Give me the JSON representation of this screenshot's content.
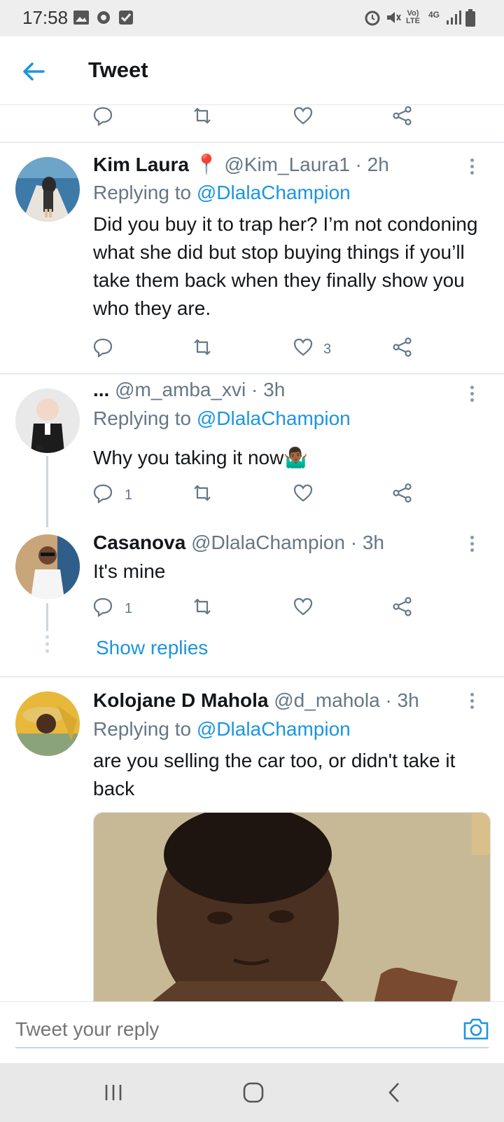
{
  "status_bar": {
    "time": "17:58",
    "network": "4G"
  },
  "header": {
    "title": "Tweet"
  },
  "tweets": [
    {
      "name": "Kim Laura",
      "handle_time": " 📍 @Kim_Laura1 · 2h",
      "replying_prefix": "Replying to ",
      "replying_to": "@DlalaChampion",
      "body": "Did you buy it to trap her? I’m not condoning what she did but stop buying things if you’ll take them back when they finally show you who they are.",
      "likes": "3"
    },
    {
      "name": "...",
      "handle_time": " @m_amba_xvi · 3h",
      "replying_prefix": "Replying to ",
      "replying_to": "@DlalaChampion",
      "body": "Why you taking it now🤷🏾‍♂️",
      "replies": "1"
    },
    {
      "name": "Casanova",
      "handle_time": " @DlalaChampion · 3h",
      "body": "It's mine",
      "replies": "1"
    },
    {
      "name": "Kolojane D Mahola",
      "handle_time": " @d_mahola · 3h",
      "replying_prefix": "Replying to ",
      "replying_to": "@DlalaChampion",
      "body": "are you selling the car too, or didn't take it back"
    }
  ],
  "show_replies": "Show replies",
  "reply_bar": {
    "placeholder": "Tweet your reply"
  },
  "colors": {
    "accent": "#1b95e0",
    "secondary_text": "#657786",
    "primary_text": "#14171a"
  }
}
